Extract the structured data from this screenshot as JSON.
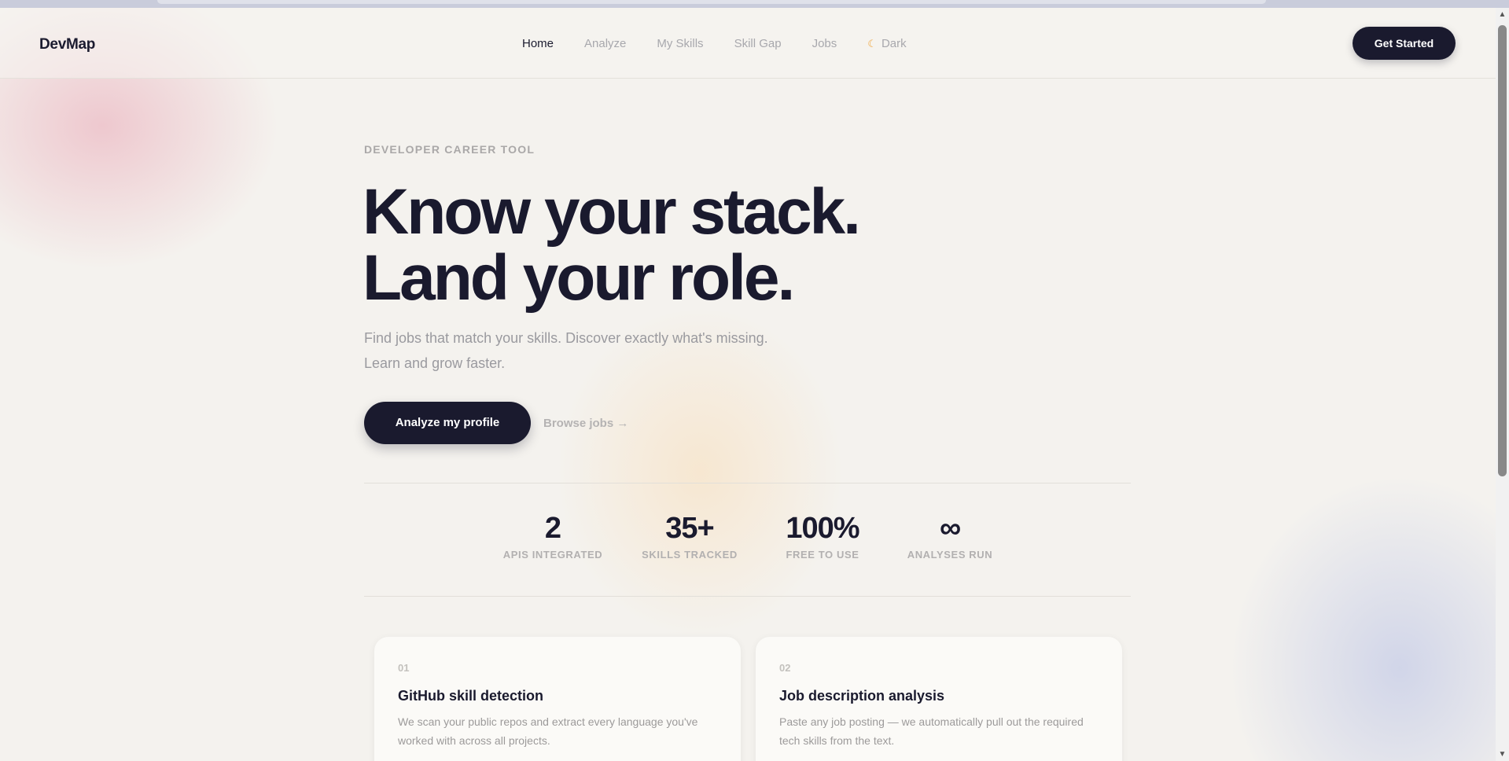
{
  "nav": {
    "logo": "DevMap",
    "links": [
      "Home",
      "Analyze",
      "My Skills",
      "Skill Gap",
      "Jobs"
    ],
    "theme_toggle": "Dark",
    "cta": "Get Started"
  },
  "hero": {
    "eyebrow": "DEVELOPER CAREER TOOL",
    "headline_line1": "Know your stack.",
    "headline_line2": "Land your role.",
    "subtitle_line1": "Find jobs that match your skills. Discover exactly what's missing.",
    "subtitle_line2": "Learn and grow faster.",
    "primary_button": "Analyze my profile",
    "secondary_link": "Browse jobs →"
  },
  "stats": [
    {
      "value": "2",
      "label": "APIS INTEGRATED"
    },
    {
      "value": "35+",
      "label": "SKILLS TRACKED"
    },
    {
      "value": "100%",
      "label": "FREE TO USE"
    },
    {
      "value": "∞",
      "label": "ANALYSES RUN"
    }
  ],
  "features": [
    {
      "index": "01",
      "title": "GitHub skill detection",
      "description": "We scan your public repos and extract every language you've worked with across all projects."
    },
    {
      "index": "02",
      "title": "Job description analysis",
      "description": "Paste any job posting — we automatically pull out the required tech skills from the text."
    }
  ],
  "colors": {
    "primary": "#1a1a2e",
    "background": "#f4f2ee",
    "muted_text": "#9a9a9f",
    "theme_icon": "#f0a53a"
  },
  "icons": {
    "theme_toggle": "moon-icon",
    "secondary_link": "arrow-right-icon"
  }
}
